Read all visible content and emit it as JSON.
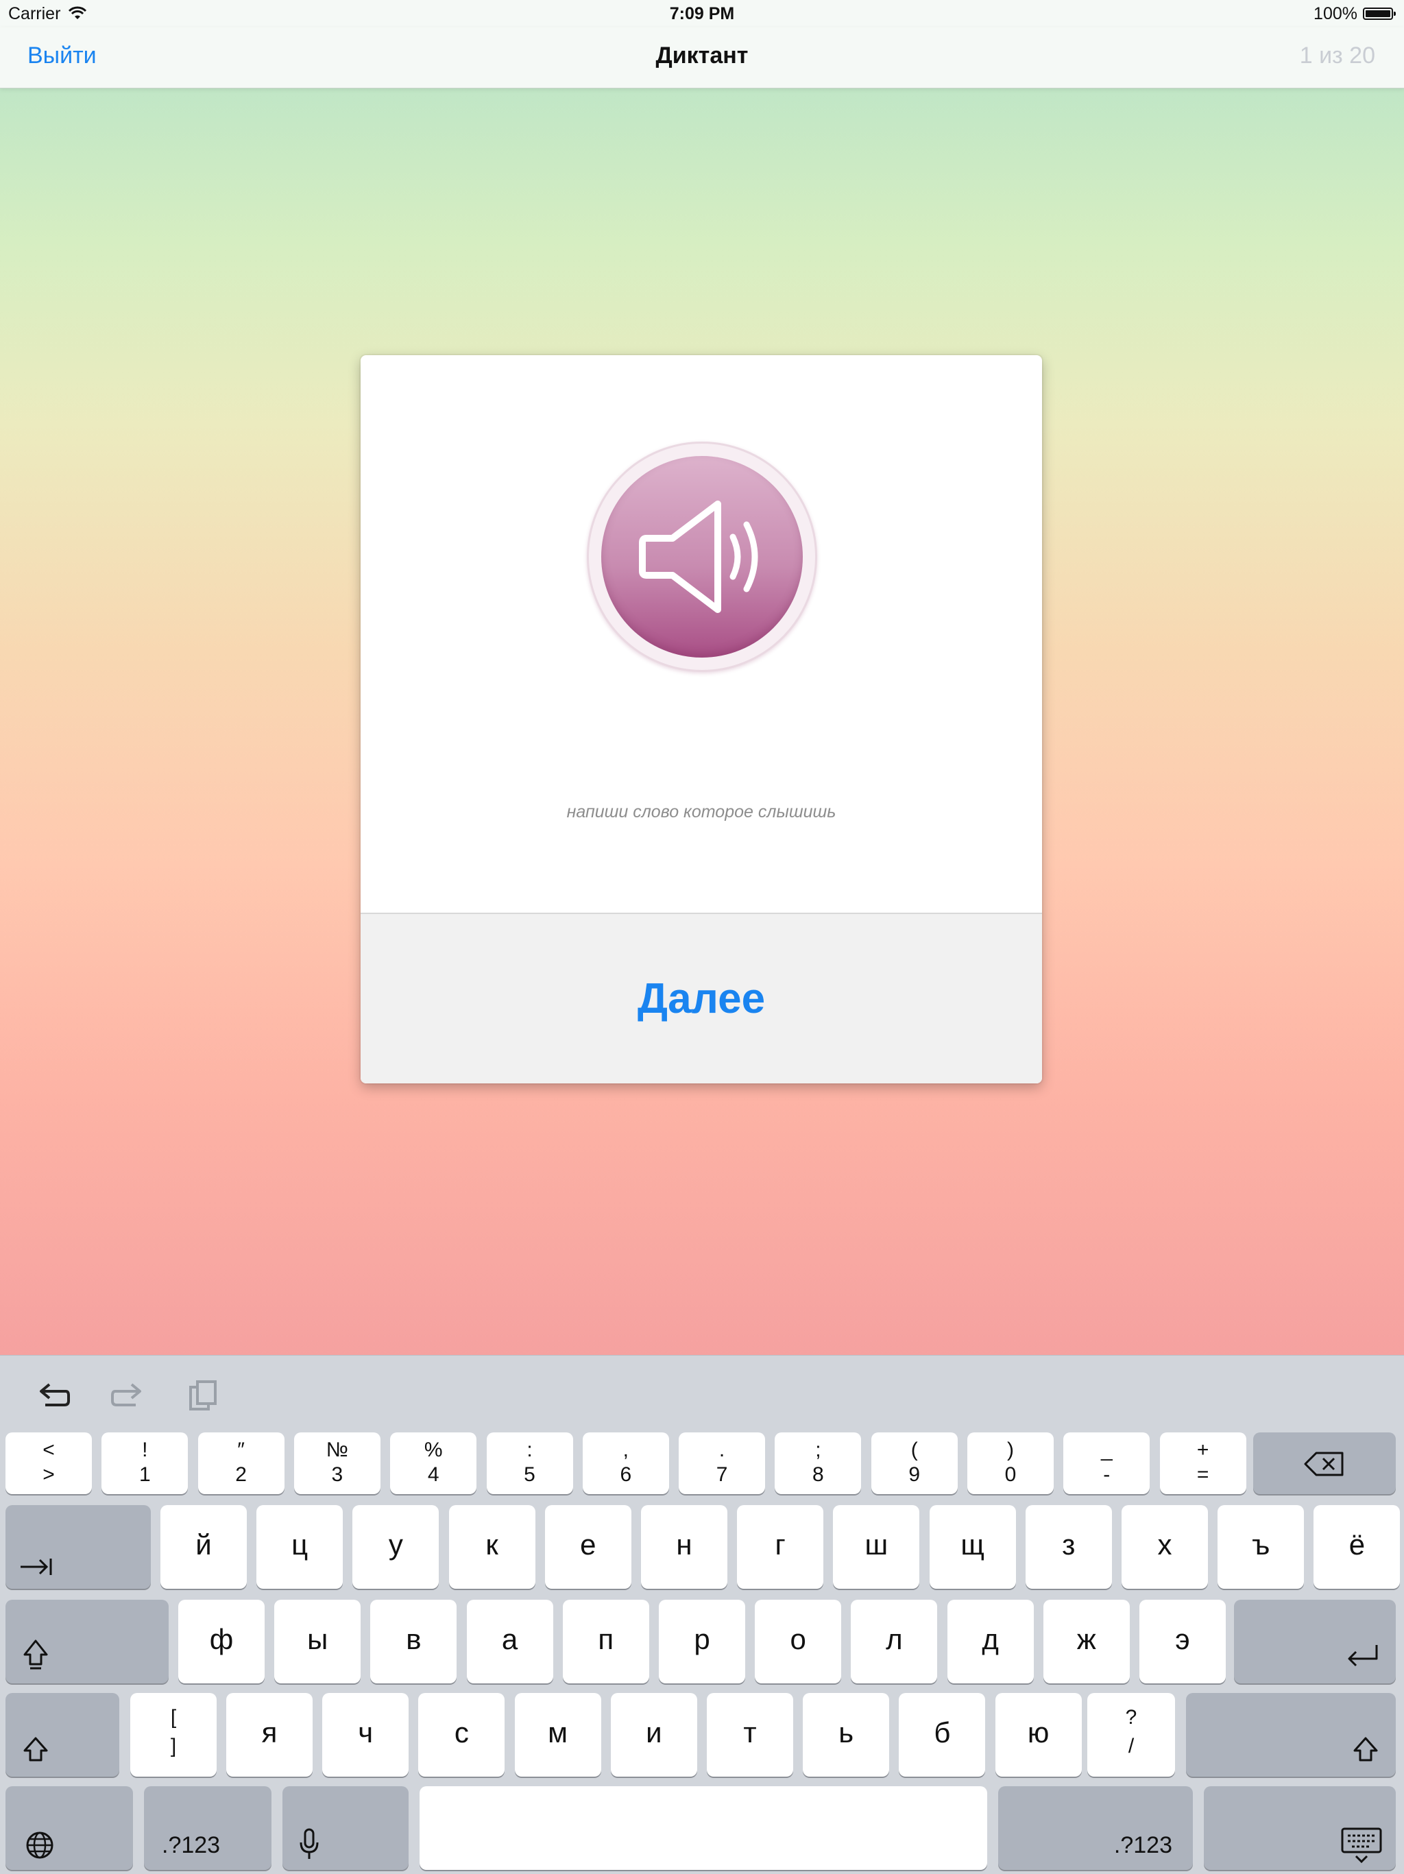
{
  "status": {
    "carrier": "Carrier",
    "time": "7:09 PM",
    "battery": "100%"
  },
  "nav": {
    "back": "Выйти",
    "title": "Диктант",
    "counter": "1 из 20"
  },
  "card": {
    "hint": "напиши слово которое слышишь",
    "next": "Далее"
  },
  "keyboard": {
    "row1": [
      {
        "top": "<",
        "bot": ">"
      },
      {
        "top": "!",
        "bot": "1"
      },
      {
        "top": "″",
        "bot": "2"
      },
      {
        "top": "№",
        "bot": "3"
      },
      {
        "top": "%",
        "bot": "4"
      },
      {
        "top": ":",
        "bot": "5"
      },
      {
        "top": ",",
        "bot": "6"
      },
      {
        "top": ".",
        "bot": "7"
      },
      {
        "top": ";",
        "bot": "8"
      },
      {
        "top": "(",
        "bot": "9"
      },
      {
        "top": ")",
        "bot": "0"
      },
      {
        "top": "_",
        "bot": "-"
      },
      {
        "top": "+",
        "bot": "="
      }
    ],
    "row2": [
      "й",
      "ц",
      "у",
      "к",
      "е",
      "н",
      "г",
      "ш",
      "щ",
      "з",
      "х",
      "ъ",
      "ё"
    ],
    "row3": [
      "ф",
      "ы",
      "в",
      "а",
      "п",
      "р",
      "о",
      "л",
      "д",
      "ж",
      "э"
    ],
    "row4_left": {
      "top": "[",
      "bot": "]"
    },
    "row4": [
      "я",
      "ч",
      "с",
      "м",
      "и",
      "т",
      "ь",
      "б",
      "ю"
    ],
    "row4_right": {
      "top": "?",
      "bot": "/"
    },
    "num_label": ".?123"
  }
}
